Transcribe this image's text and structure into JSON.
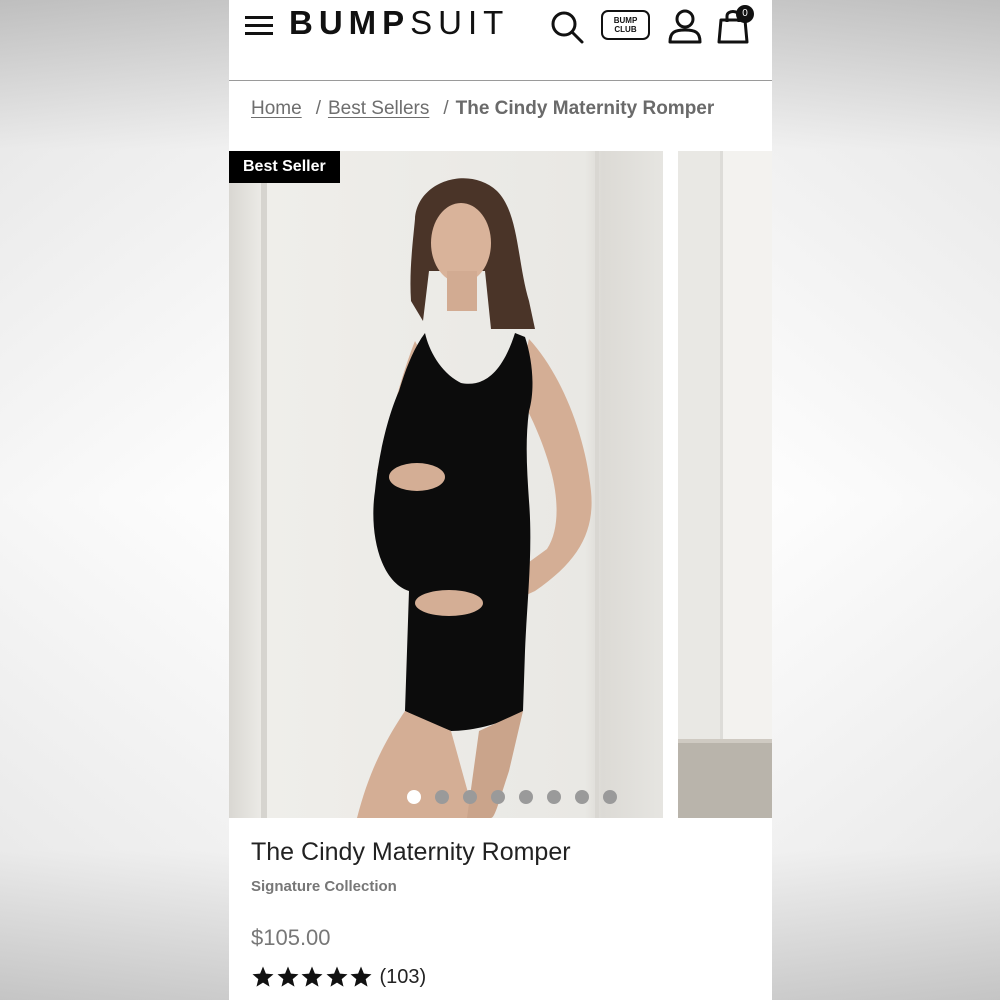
{
  "header": {
    "logo_bold": "BUMP",
    "logo_light": "SUIT",
    "club_badge_line1": "BUMP",
    "club_badge_line2": "CLUB",
    "cart_count": "0"
  },
  "breadcrumb": {
    "home": "Home",
    "separator": "/",
    "category": "Best Sellers",
    "current": "The Cindy Maternity Romper"
  },
  "gallery": {
    "badge": "Best Seller",
    "image_count": 8,
    "active_index": 0
  },
  "product": {
    "title": "The Cindy Maternity Romper",
    "collection": "Signature Collection",
    "price": "$105.00",
    "rating_stars": 5,
    "review_count": "(103)"
  },
  "icons": {
    "menu": "menu-icon",
    "search": "search-icon",
    "account": "account-icon",
    "cart": "shopping-bag-icon",
    "star": "star-icon"
  },
  "colors": {
    "text": "#222222",
    "muted": "#777777",
    "badge_bg": "#000000",
    "dot_inactive": "#9a9a9a",
    "dot_active": "#ffffff"
  }
}
